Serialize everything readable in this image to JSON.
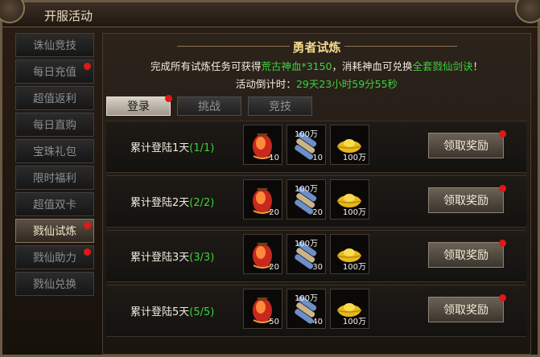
{
  "window": {
    "title": "开服活动"
  },
  "sidebar": {
    "items": [
      {
        "label": "诛仙竞技",
        "active": false,
        "dot": false
      },
      {
        "label": "每日充值",
        "active": false,
        "dot": true
      },
      {
        "label": "超值返利",
        "active": false,
        "dot": false
      },
      {
        "label": "每日直购",
        "active": false,
        "dot": false
      },
      {
        "label": "宝珠礼包",
        "active": false,
        "dot": false
      },
      {
        "label": "限时福利",
        "active": false,
        "dot": false
      },
      {
        "label": "超值双卡",
        "active": false,
        "dot": false
      },
      {
        "label": "戮仙试炼",
        "active": true,
        "dot": true
      },
      {
        "label": "戮仙助力",
        "active": false,
        "dot": true
      },
      {
        "label": "戮仙兑换",
        "active": false,
        "dot": false
      }
    ]
  },
  "banner": {
    "title": "勇者试炼",
    "desc_a": "完成所有试炼任务可获得",
    "desc_item1": "荒古神血*3150",
    "desc_b": "，消耗神血可兑换",
    "desc_item2": "全套戮仙剑诀",
    "desc_c": "！",
    "countdown_label": "活动倒计时：",
    "countdown_value": "29天23小时59分55秒"
  },
  "tabs": [
    {
      "label": "登录",
      "active": true,
      "dot": true
    },
    {
      "label": "挑战",
      "active": false,
      "dot": false
    },
    {
      "label": "竞技",
      "active": false,
      "dot": false
    }
  ],
  "rows": [
    {
      "label": "累计登陆1天",
      "progress": "(1/1)",
      "rewards": [
        {
          "icon": "blood-potion-icon",
          "qty": "10"
        },
        {
          "icon": "scroll-icon",
          "qty": "10",
          "top": "100万"
        },
        {
          "icon": "gold-ingot-icon",
          "qty": "100万"
        }
      ],
      "button": "领取奖励"
    },
    {
      "label": "累计登陆2天",
      "progress": "(2/2)",
      "rewards": [
        {
          "icon": "blood-potion-icon",
          "qty": "20"
        },
        {
          "icon": "scroll-icon",
          "qty": "20",
          "top": "100万"
        },
        {
          "icon": "gold-ingot-icon",
          "qty": "100万"
        }
      ],
      "button": "领取奖励"
    },
    {
      "label": "累计登陆3天",
      "progress": "(3/3)",
      "rewards": [
        {
          "icon": "blood-potion-icon",
          "qty": "20"
        },
        {
          "icon": "scroll-icon",
          "qty": "30",
          "top": "100万"
        },
        {
          "icon": "gold-ingot-icon",
          "qty": "100万"
        }
      ],
      "button": "领取奖励"
    },
    {
      "label": "累计登陆5天",
      "progress": "(5/5)",
      "rewards": [
        {
          "icon": "blood-potion-icon",
          "qty": "50"
        },
        {
          "icon": "scroll-icon",
          "qty": "40",
          "top": "100万"
        },
        {
          "icon": "gold-ingot-icon",
          "qty": "100万"
        }
      ],
      "button": "领取奖励"
    }
  ]
}
